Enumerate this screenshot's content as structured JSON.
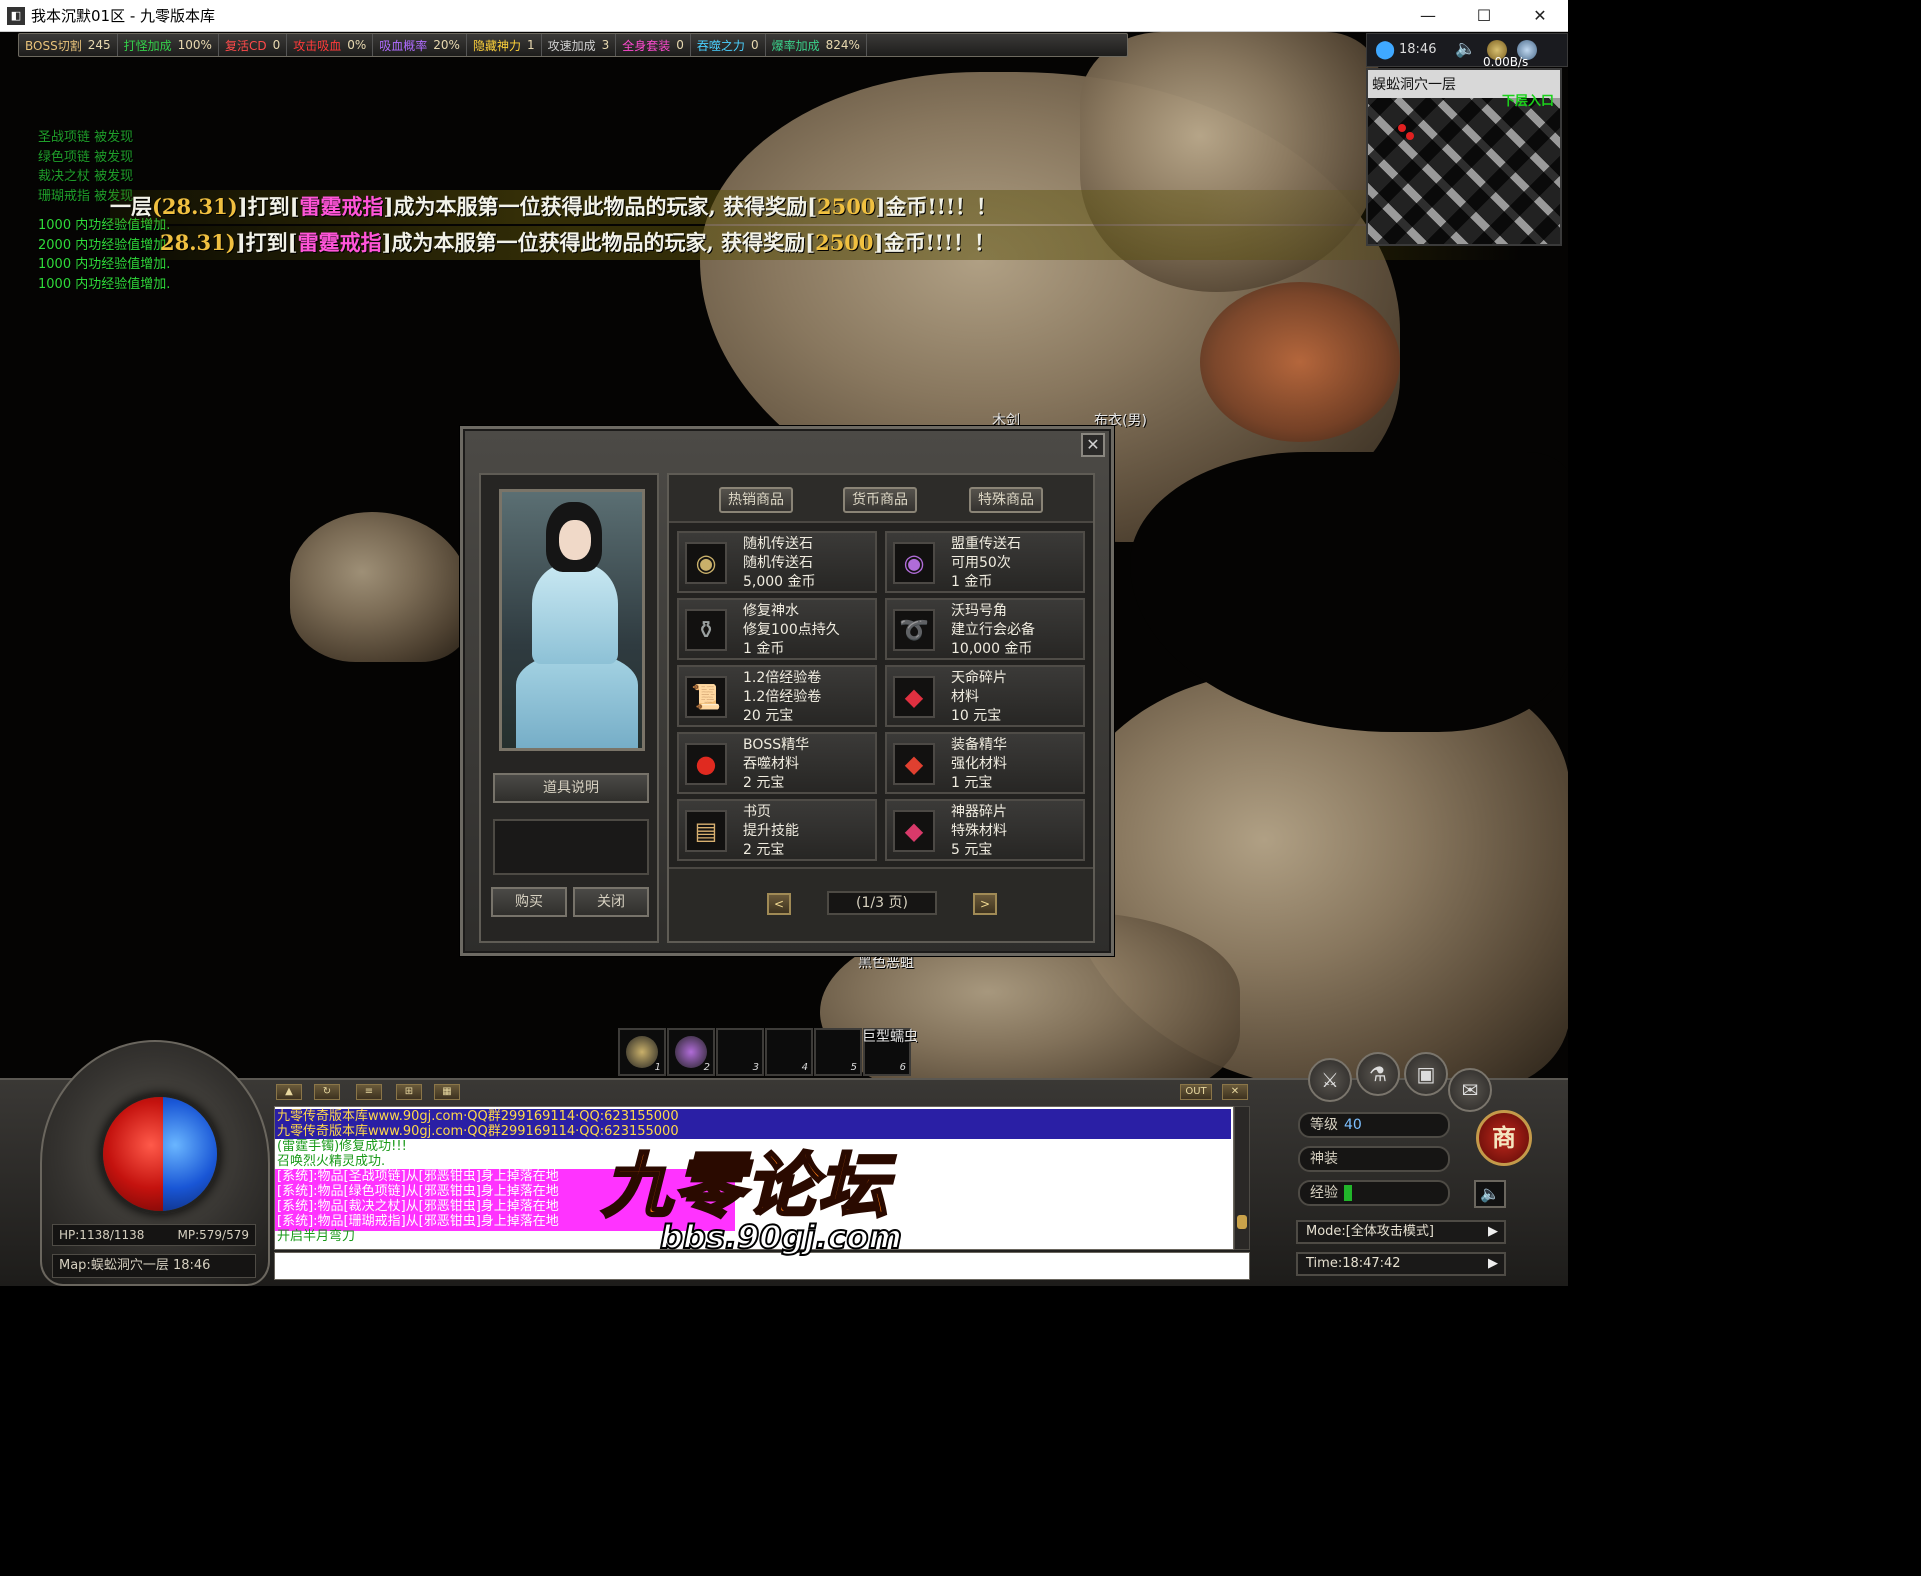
{
  "window": {
    "title": "我本沉默01区 - 九零版本库",
    "icon": "app-icon",
    "minimize": "—",
    "maximize": "☐",
    "close": "✕"
  },
  "stats_bar": [
    {
      "label": "BOSS切割",
      "value": "245",
      "color": "#e8c27a"
    },
    {
      "label": "打怪加成",
      "value": "100%",
      "color": "#34d04a"
    },
    {
      "label": "复活CD",
      "value": "0",
      "color": "#ff4a4a"
    },
    {
      "label": "攻击吸血",
      "value": "0%",
      "color": "#ff3a3a"
    },
    {
      "label": "吸血概率",
      "value": "20%",
      "color": "#b06cff"
    },
    {
      "label": "隐藏神力",
      "value": "1",
      "color": "#ffd23a"
    },
    {
      "label": "攻速加成",
      "value": "3",
      "color": "#d0d0d0"
    },
    {
      "label": "全身套装",
      "value": "0",
      "color": "#ff4ad0"
    },
    {
      "label": "吞噬之力",
      "value": "0",
      "color": "#4ad0ff"
    },
    {
      "label": "爆率加成",
      "value": "824%",
      "color": "#3ad08a"
    }
  ],
  "system_log": {
    "found": [
      "圣战项链 被发现",
      "绿色项链 被发现",
      "裁决之杖 被发现",
      "珊瑚戒指 被发现"
    ],
    "exp": [
      "1000 内功经验值增加.",
      "2000 内功经验值增加.",
      "1000 内功经验值增加.",
      "1000 内功经验值增加."
    ]
  },
  "banners": [
    {
      "prefix": "一层",
      "coord": "(28.31)",
      "verb": "]打到[",
      "item": "雷霆戒指",
      "mid": "]成为本服第一位获得此物品的玩家, 获得奖励[",
      "reward": "2500",
      "suffix": "]金币!!!！！"
    },
    {
      "prefix": "",
      "coord": "28.31)",
      "verb": "]打到[",
      "item": "雷霆戒指",
      "mid": "]成为本服第一位获得此物品的玩家, 获得奖励[",
      "reward": "2500",
      "suffix": "]金币!!!！！"
    }
  ],
  "world_labels": {
    "npc_a": "木剑",
    "npc_b": "布衣(男)",
    "npc_c": "黑色恶蛆",
    "hotbar_caption": "巨型蠕虫"
  },
  "minimap": {
    "clock": "18:46",
    "net_speed": "0.00B/s",
    "map_name": "蜈蚣洞穴一层",
    "exit_label": "下层入口"
  },
  "shop": {
    "close_glyph": "✕",
    "tabs": [
      "热销商品",
      "货币商品",
      "特殊商品"
    ],
    "items": [
      {
        "name": "随机传送石",
        "desc": "随机传送石",
        "price": "5,000 金币",
        "icon": "scroll-stone-icon",
        "glyph": "◉",
        "color": "#c9b06a"
      },
      {
        "name": "盟重传送石",
        "desc": "可用50次",
        "price": "1 金币",
        "icon": "purple-stone-icon",
        "glyph": "◉",
        "color": "#b06cd8"
      },
      {
        "name": "修复神水",
        "desc": "修复100点持久",
        "price": "1 金币",
        "icon": "potion-icon",
        "glyph": "⚱",
        "color": "#9aa0a0"
      },
      {
        "name": "沃玛号角",
        "desc": "建立行会必备",
        "price": "10,000 金币",
        "icon": "horn-icon",
        "glyph": "➰",
        "color": "#c8a060"
      },
      {
        "name": "1.2倍经验卷",
        "desc": "1.2倍经验卷",
        "price": "20 元宝",
        "icon": "scroll-icon",
        "glyph": "📜",
        "color": "#d8c090"
      },
      {
        "name": "天命碎片",
        "desc": "材料",
        "price": "10 元宝",
        "icon": "red-crystal-icon",
        "glyph": "◆",
        "color": "#e03040"
      },
      {
        "name": "BOSS精华",
        "desc": "吞噬材料",
        "price": "2 元宝",
        "icon": "boss-essence-icon",
        "glyph": "●",
        "color": "#e02a20"
      },
      {
        "name": "装备精华",
        "desc": "强化材料",
        "price": "1 元宝",
        "icon": "equip-essence-icon",
        "glyph": "◆",
        "color": "#e04030"
      },
      {
        "name": "书页",
        "desc": "提升技能",
        "price": "2 元宝",
        "icon": "book-page-icon",
        "glyph": "▤",
        "color": "#d8b070"
      },
      {
        "name": "神器碎片",
        "desc": "特殊材料",
        "price": "5 元宝",
        "icon": "artifact-shard-icon",
        "glyph": "◆",
        "color": "#d83a6a"
      }
    ],
    "item_desc_button": "道具说明",
    "buy_button": "购买",
    "close_button": "关闭",
    "prev": "<",
    "next": ">",
    "page": "(1/3 页)"
  },
  "hotbar": [
    {
      "num": "1",
      "color": "#c9b06a"
    },
    {
      "num": "2",
      "color": "#b06cd8"
    },
    {
      "num": "3",
      "color": ""
    },
    {
      "num": "4",
      "color": ""
    },
    {
      "num": "5",
      "color": ""
    },
    {
      "num": "6",
      "color": ""
    }
  ],
  "hud": {
    "hp": "HP:1138/1138",
    "mp": "MP:579/579",
    "map": "Map:蜈蚣洞穴一层 18:46",
    "chat_tools": [
      "▲",
      "↻",
      "≡",
      "⊞",
      "▦"
    ],
    "chat_out": "OUT",
    "chat_x": "✕",
    "level_label": "等级",
    "level_value": "40",
    "gear_label": "神装",
    "exp_label": "经验",
    "mode": "Mode:[全体攻击模式]",
    "time": "Time:18:47:42",
    "shop_button": "商",
    "sound": "🔈",
    "round_buttons": [
      "⚔",
      "⚗",
      "▣",
      "✉"
    ]
  },
  "chat": {
    "lines": [
      {
        "text": "九零传奇版本库www.90gj.com·QQ群299169114·QQ:623155000",
        "color": "#ffd84a"
      },
      {
        "text": "九零传奇版本库www.90gj.com·QQ群299169114·QQ:623155000",
        "color": "#ffd84a"
      },
      {
        "text": "(雷霆手镯)修复成功!!!",
        "color": "#1a9a1a"
      },
      {
        "text": "召唤烈火精灵成功.",
        "color": "#1a9a1a"
      },
      {
        "text": "[系统]:物品[圣战项链]从[邪恶钳虫]身上掉落在地",
        "color": "#ffffff"
      },
      {
        "text": "[系统]:物品[绿色项链]从[邪恶钳虫]身上掉落在地",
        "color": "#ffffff"
      },
      {
        "text": "[系统]:物品[裁决之杖]从[邪恶钳虫]身上掉落在地",
        "color": "#ffffff"
      },
      {
        "text": "[系统]:物品[珊瑚戒指]从[邪恶钳虫]身上掉落在地",
        "color": "#ffffff"
      },
      {
        "text": "开启半月弯刀",
        "color": "#1a9a1a"
      }
    ]
  },
  "watermark": {
    "title": "九零论坛",
    "url": "bbs.90gj.com"
  }
}
